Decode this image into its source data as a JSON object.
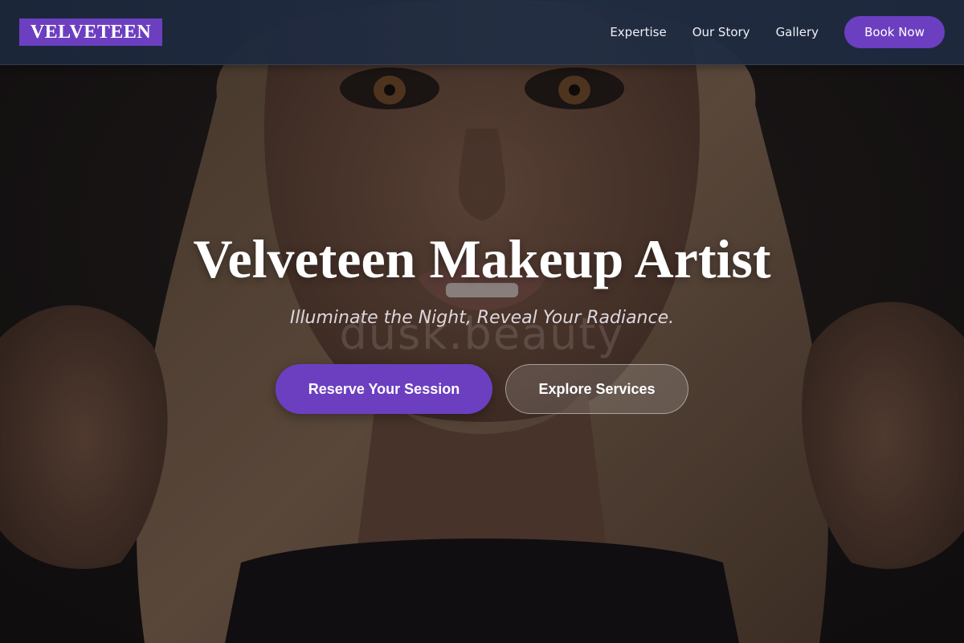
{
  "brand": {
    "name": "VELVETEEN",
    "accent": "#6c3fc1"
  },
  "nav": {
    "links": [
      {
        "label": "Expertise"
      },
      {
        "label": "Our Story"
      },
      {
        "label": "Gallery"
      }
    ],
    "cta_label": "Book Now"
  },
  "hero": {
    "title": "Velveteen Makeup Artist",
    "tagline": "Illuminate the Night, Reveal Your Radiance.",
    "watermark": "dusk.beauty",
    "primary_button": "Reserve Your Session",
    "secondary_button": "Explore Services",
    "background_image": "portrait-photo"
  },
  "colors": {
    "navbar_bg": "#1e2a40",
    "primary": "#6c3fc1",
    "text_light": "#ffffff"
  }
}
